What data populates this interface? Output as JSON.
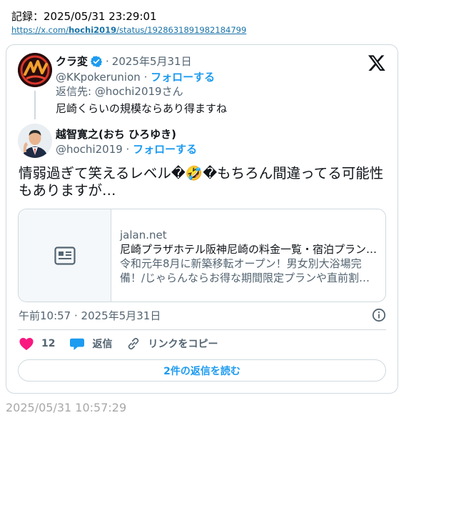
{
  "record": {
    "label": "記録：2025/05/31 23:29:01",
    "url_prefix": "https://x.com/",
    "url_user": "hochi2019",
    "url_suffix": "/status/1928631891982184799"
  },
  "parent_tweet": {
    "name": "クラ変",
    "date_sep": "·",
    "date": "2025年5月31日",
    "handle": "@KKpokerunion",
    "handle_sep": " · ",
    "follow_label": "フォローする",
    "reply_to": "返信先: @hochi2019さん",
    "text": "尼崎くらいの規模ならあり得ますね"
  },
  "main_tweet": {
    "name": "越智寛之(おち ひろゆき)",
    "handle": "@hochi2019",
    "handle_sep": " · ",
    "follow_label": "フォローする",
    "text": "情弱過ぎて笑えるレベル�🤣�もちろん間違ってる可能性もありますが…",
    "timestamp": "午前10:57 · 2025年5月31日"
  },
  "link_card": {
    "domain": "jalan.net",
    "title": "尼崎プラザホテル阪神尼崎の料金一覧・宿泊プラン…",
    "description": "令和元年8月に新築移転オープン！男女別大浴場完備！/じゃらんならお得な期間限定プランや直前割…"
  },
  "actions": {
    "like_count": "12",
    "reply_label": "返信",
    "copy_link_label": "リンクをコピー",
    "read_replies_label": "2件の返信を読む"
  },
  "captured_at": "2025/05/31 10:57:29",
  "colors": {
    "accent": "#1d9bf0",
    "like": "#f91880",
    "muted": "#536471",
    "border": "#cfd9de"
  },
  "icons": [
    "x-logo-icon",
    "verified-badge-icon",
    "article-icon",
    "info-icon",
    "heart-icon",
    "reply-bubble-icon",
    "link-icon"
  ]
}
